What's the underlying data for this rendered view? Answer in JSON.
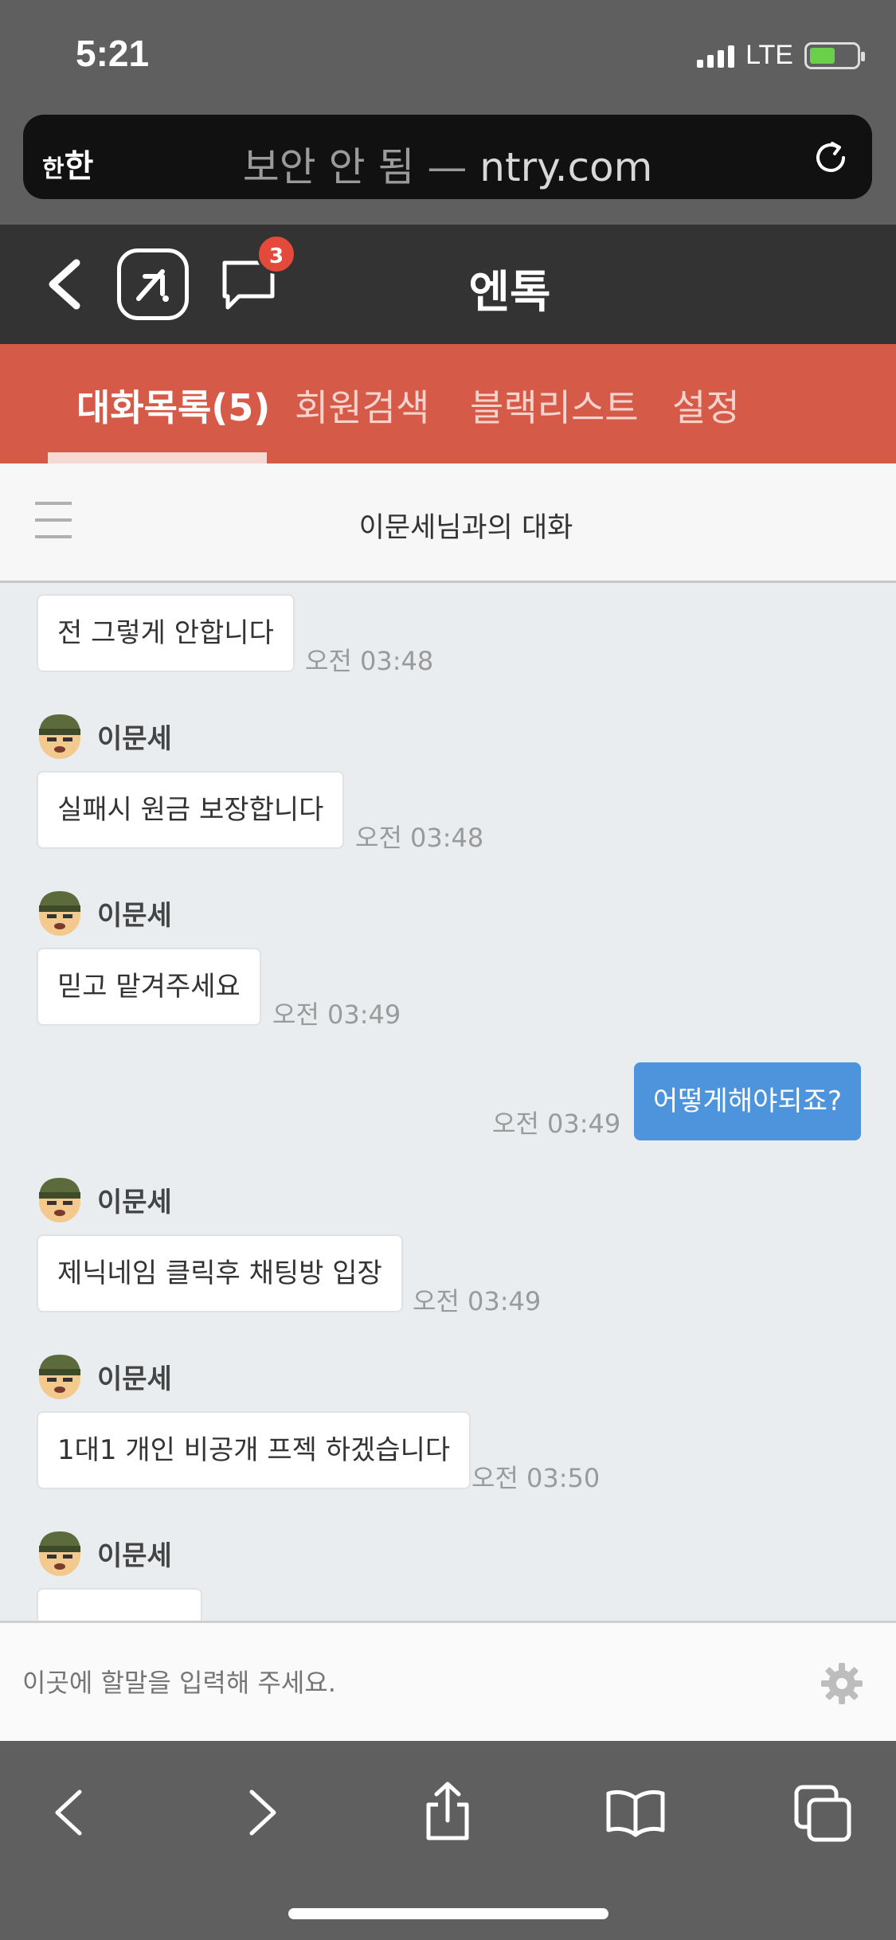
{
  "status_bar": {
    "time": "5:21",
    "network": "LTE"
  },
  "url_bar": {
    "text_size_label": "한",
    "text_size_label_big": "한",
    "security_text": "보안 안 됨 — ",
    "domain": "ntry.com"
  },
  "header": {
    "title": "엔톡",
    "chat_badge_count": "3"
  },
  "tabs": [
    {
      "label": "대화목록(5)",
      "active": true
    },
    {
      "label": "회원검색",
      "active": false
    },
    {
      "label": "블랙리스트",
      "active": false
    },
    {
      "label": "설정",
      "active": false
    }
  ],
  "conversation": {
    "title": "이문세님과의 대화"
  },
  "messages": [
    {
      "sender": "",
      "text": "전 그렇게 안합니다",
      "time": "오전 03:48",
      "mine": false
    },
    {
      "sender": "이문세",
      "text": "실패시 원금 보장합니다",
      "time": "오전 03:48",
      "mine": false
    },
    {
      "sender": "이문세",
      "text": "믿고 맡겨주세요",
      "time": "오전 03:49",
      "mine": false
    },
    {
      "sender": "",
      "text": "어떻게해야되죠?",
      "time": "오전 03:49",
      "mine": true
    },
    {
      "sender": "이문세",
      "text": "제닉네임 클릭후 채팅방 입장",
      "time": "오전 03:49",
      "mine": false
    },
    {
      "sender": "이문세",
      "text": "1대1 개인 비공개 프젝 하겠습니다",
      "time": "오전 03:50",
      "mine": false
    },
    {
      "sender": "이문세",
      "text": "",
      "time": "",
      "mine": false
    }
  ],
  "input": {
    "placeholder": "이곳에 할말을 입력해 주세요."
  },
  "colors": {
    "header_bg": "#333333",
    "tab_bg": "#d65a48",
    "my_bubble": "#4e94dc",
    "badge": "#e44a3c"
  }
}
